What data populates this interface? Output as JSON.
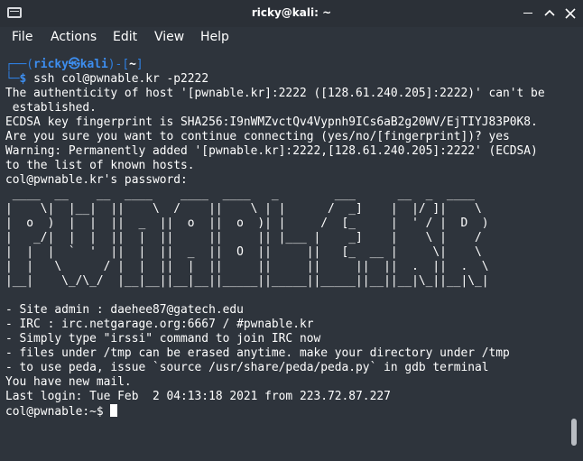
{
  "window": {
    "title": "ricky@kali: ~"
  },
  "menu": {
    "items": [
      "File",
      "Actions",
      "Edit",
      "View",
      "Help"
    ]
  },
  "prompt": {
    "user": "ricky",
    "at_symbol": "㉿",
    "host": "kali",
    "dir": "~",
    "command": "ssh col@pwnable.kr -p2222"
  },
  "output": {
    "line1": "The authenticity of host '[pwnable.kr]:2222 ([128.61.240.205]:2222)' can't be",
    "line2": " established.",
    "line3": "ECDSA key fingerprint is SHA256:I9nWMZvctQv4Vypnh9ICs6aB2g20WV/EjTIYJ83P0K8.",
    "line4": "Are you sure you want to continue connecting (yes/no/[fingerprint])? yes",
    "line5": "Warning: Permanently added '[pwnable.kr]:2222,[128.61.240.205]:2222' (ECDSA)",
    "line6": "to the list of known hosts.",
    "line7": "col@pwnable.kr's password:"
  },
  "banner": {
    "art": " ____  __    __  ____    ____  ____   _        ___      __  _  ____\n|    \\|  |__|  ||    \\  /    ||    \\ | |      /  _]    |  |/ ]|    \\\n|  o  )  |  |  ||  _  ||  o  ||  o  )| |     /  [_     |  ' / |  D  )\n|   _/|  |  |  ||  |  ||     ||     || |___ |    _]    |    \\ |    /\n|  |  |  `  '  ||  |  ||  _  ||  O  ||     ||   [_  __ |     \\|    \\\n|  |   \\      / |  |  ||  |  ||     ||     ||     ||  ||  .  ||  .  \\\n|__|    \\_/\\_/  |__|__||__|__||_____||_____||_____||__||__|\\_||__|\\_|"
  },
  "motd": {
    "line1": "- Site admin : daehee87@gatech.edu",
    "line2": "- IRC : irc.netgarage.org:6667 / #pwnable.kr",
    "line3": "- Simply type \"irssi\" command to join IRC now",
    "line4": "- files under /tmp can be erased anytime. make your directory under /tmp",
    "line5": "- to use peda, issue `source /usr/share/peda/peda.py` in gdb terminal",
    "line6": "You have new mail.",
    "line7": "Last login: Tue Feb  2 04:13:18 2021 from 223.72.87.227",
    "remote_prompt": "col@pwnable:~$ "
  },
  "colors": {
    "background": "#2e343c",
    "prompt_blue": "#3d8ef0",
    "text": "#ffffff"
  }
}
